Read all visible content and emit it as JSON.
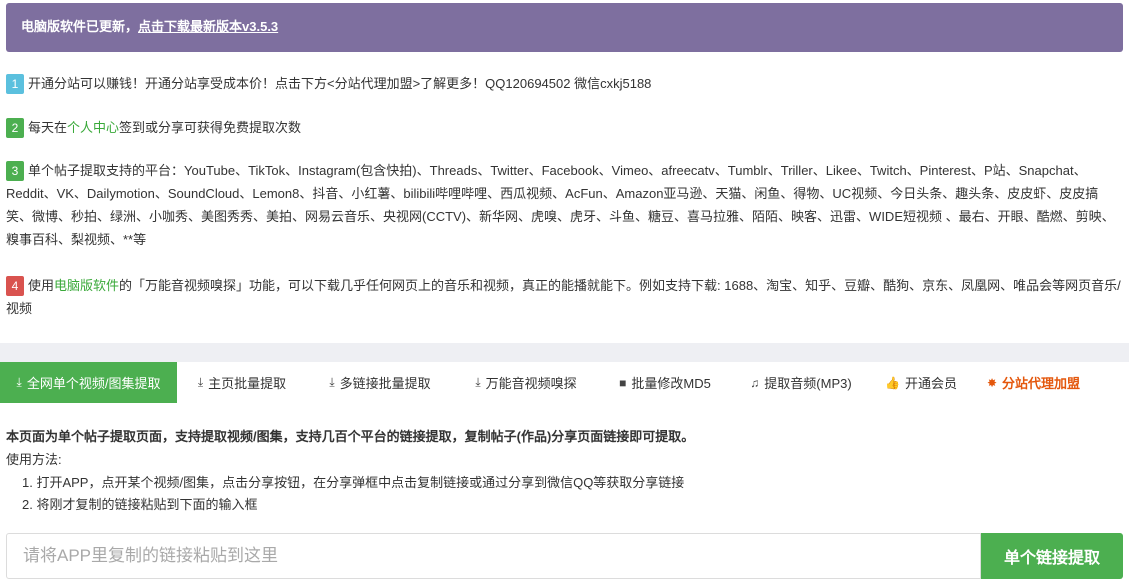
{
  "banner": {
    "text": "电脑版软件已更新，",
    "link": "点击下载最新版本v3.5.3"
  },
  "notices": [
    {
      "num": "1",
      "color": "#5bc0de",
      "text": "开通分站可以赚钱！开通分站享受成本价！点击下方<分站代理加盟>了解更多！QQ120694502 微信cxkj5188"
    },
    {
      "num": "2",
      "color": "#4caf50",
      "pre": "每天在",
      "link": "个人中心",
      "post": "签到或分享可获得免费提取次数"
    },
    {
      "num": "3",
      "color": "#4caf50",
      "text": "单个帖子提取支持的平台：YouTube、TikTok、Instagram(包含快拍)、Threads、Twitter、Facebook、Vimeo、afreecatv、Tumblr、Triller、Likee、Twitch、Pinterest、P站、Snapchat、Reddit、VK、Dailymotion、SoundCloud、Lemon8、抖音、小红薯、bilibili哔哩哔哩、西瓜视频、AcFun、Amazon亚马逊、天猫、闲鱼、得物、UC视频、今日头条、趣头条、皮皮虾、皮皮搞笑、微博、秒拍、绿洲、小咖秀、美图秀秀、美拍、网易云音乐、央视网(CCTV)、新华网、虎嗅、虎牙、斗鱼、糖豆、喜马拉雅、陌陌、映客、迅雷、WIDE短视频 、最右、开眼、酷燃、剪映、糗事百科、梨视频、**等"
    },
    {
      "num": "4",
      "color": "#d9534f",
      "pre": "使用",
      "link": "电脑版软件",
      "post": "的「万能音视频嗅探」功能，可以下载几乎任何网页上的音乐和视频，真正的能播就能下。例如支持下载: 1688、淘宝、知乎、豆瓣、酷狗、京东、凤凰网、唯品会等网页音乐/视频"
    }
  ],
  "tabs": [
    {
      "label": "全网单个视频/图集提取",
      "icon": "download-icon",
      "glyph": "⤓",
      "active": true
    },
    {
      "label": "主页批量提取",
      "icon": "download-icon",
      "glyph": "⤓"
    },
    {
      "label": "多链接批量提取",
      "icon": "download-icon",
      "glyph": "⤓"
    },
    {
      "label": "万能音视频嗅探",
      "icon": "download-icon",
      "glyph": "⤓"
    },
    {
      "label": "批量修改MD5",
      "icon": "video-camera-icon",
      "glyph": "■"
    },
    {
      "label": "提取音频(MP3)",
      "icon": "music-icon",
      "glyph": "♫"
    },
    {
      "label": "开通会员",
      "icon": "thumbs-up-icon",
      "glyph": "👍"
    },
    {
      "label": "分站代理加盟",
      "icon": "star-burst-icon",
      "glyph": "✸",
      "promo": true
    }
  ],
  "intro": "本页面为单个帖子提取页面，支持提取视频/图集，支持几百个平台的链接提取，复制帖子(作品)分享页面链接即可提取。",
  "usage_title": "使用方法:",
  "steps": [
    "1. 打开APP，点开某个视频/图集，点击分享按钮，在分享弹框中点击复制链接或通过分享到微信QQ等获取分享链接",
    "2. 将刚才复制的链接粘贴到下面的输入框"
  ],
  "input": {
    "placeholder": "请将APP里复制的链接粘贴到这里",
    "value": ""
  },
  "submit_label": "单个链接提取",
  "colors": {
    "banner": "#7e6f9f",
    "accent": "#4caf50",
    "promo": "#e4570c"
  }
}
